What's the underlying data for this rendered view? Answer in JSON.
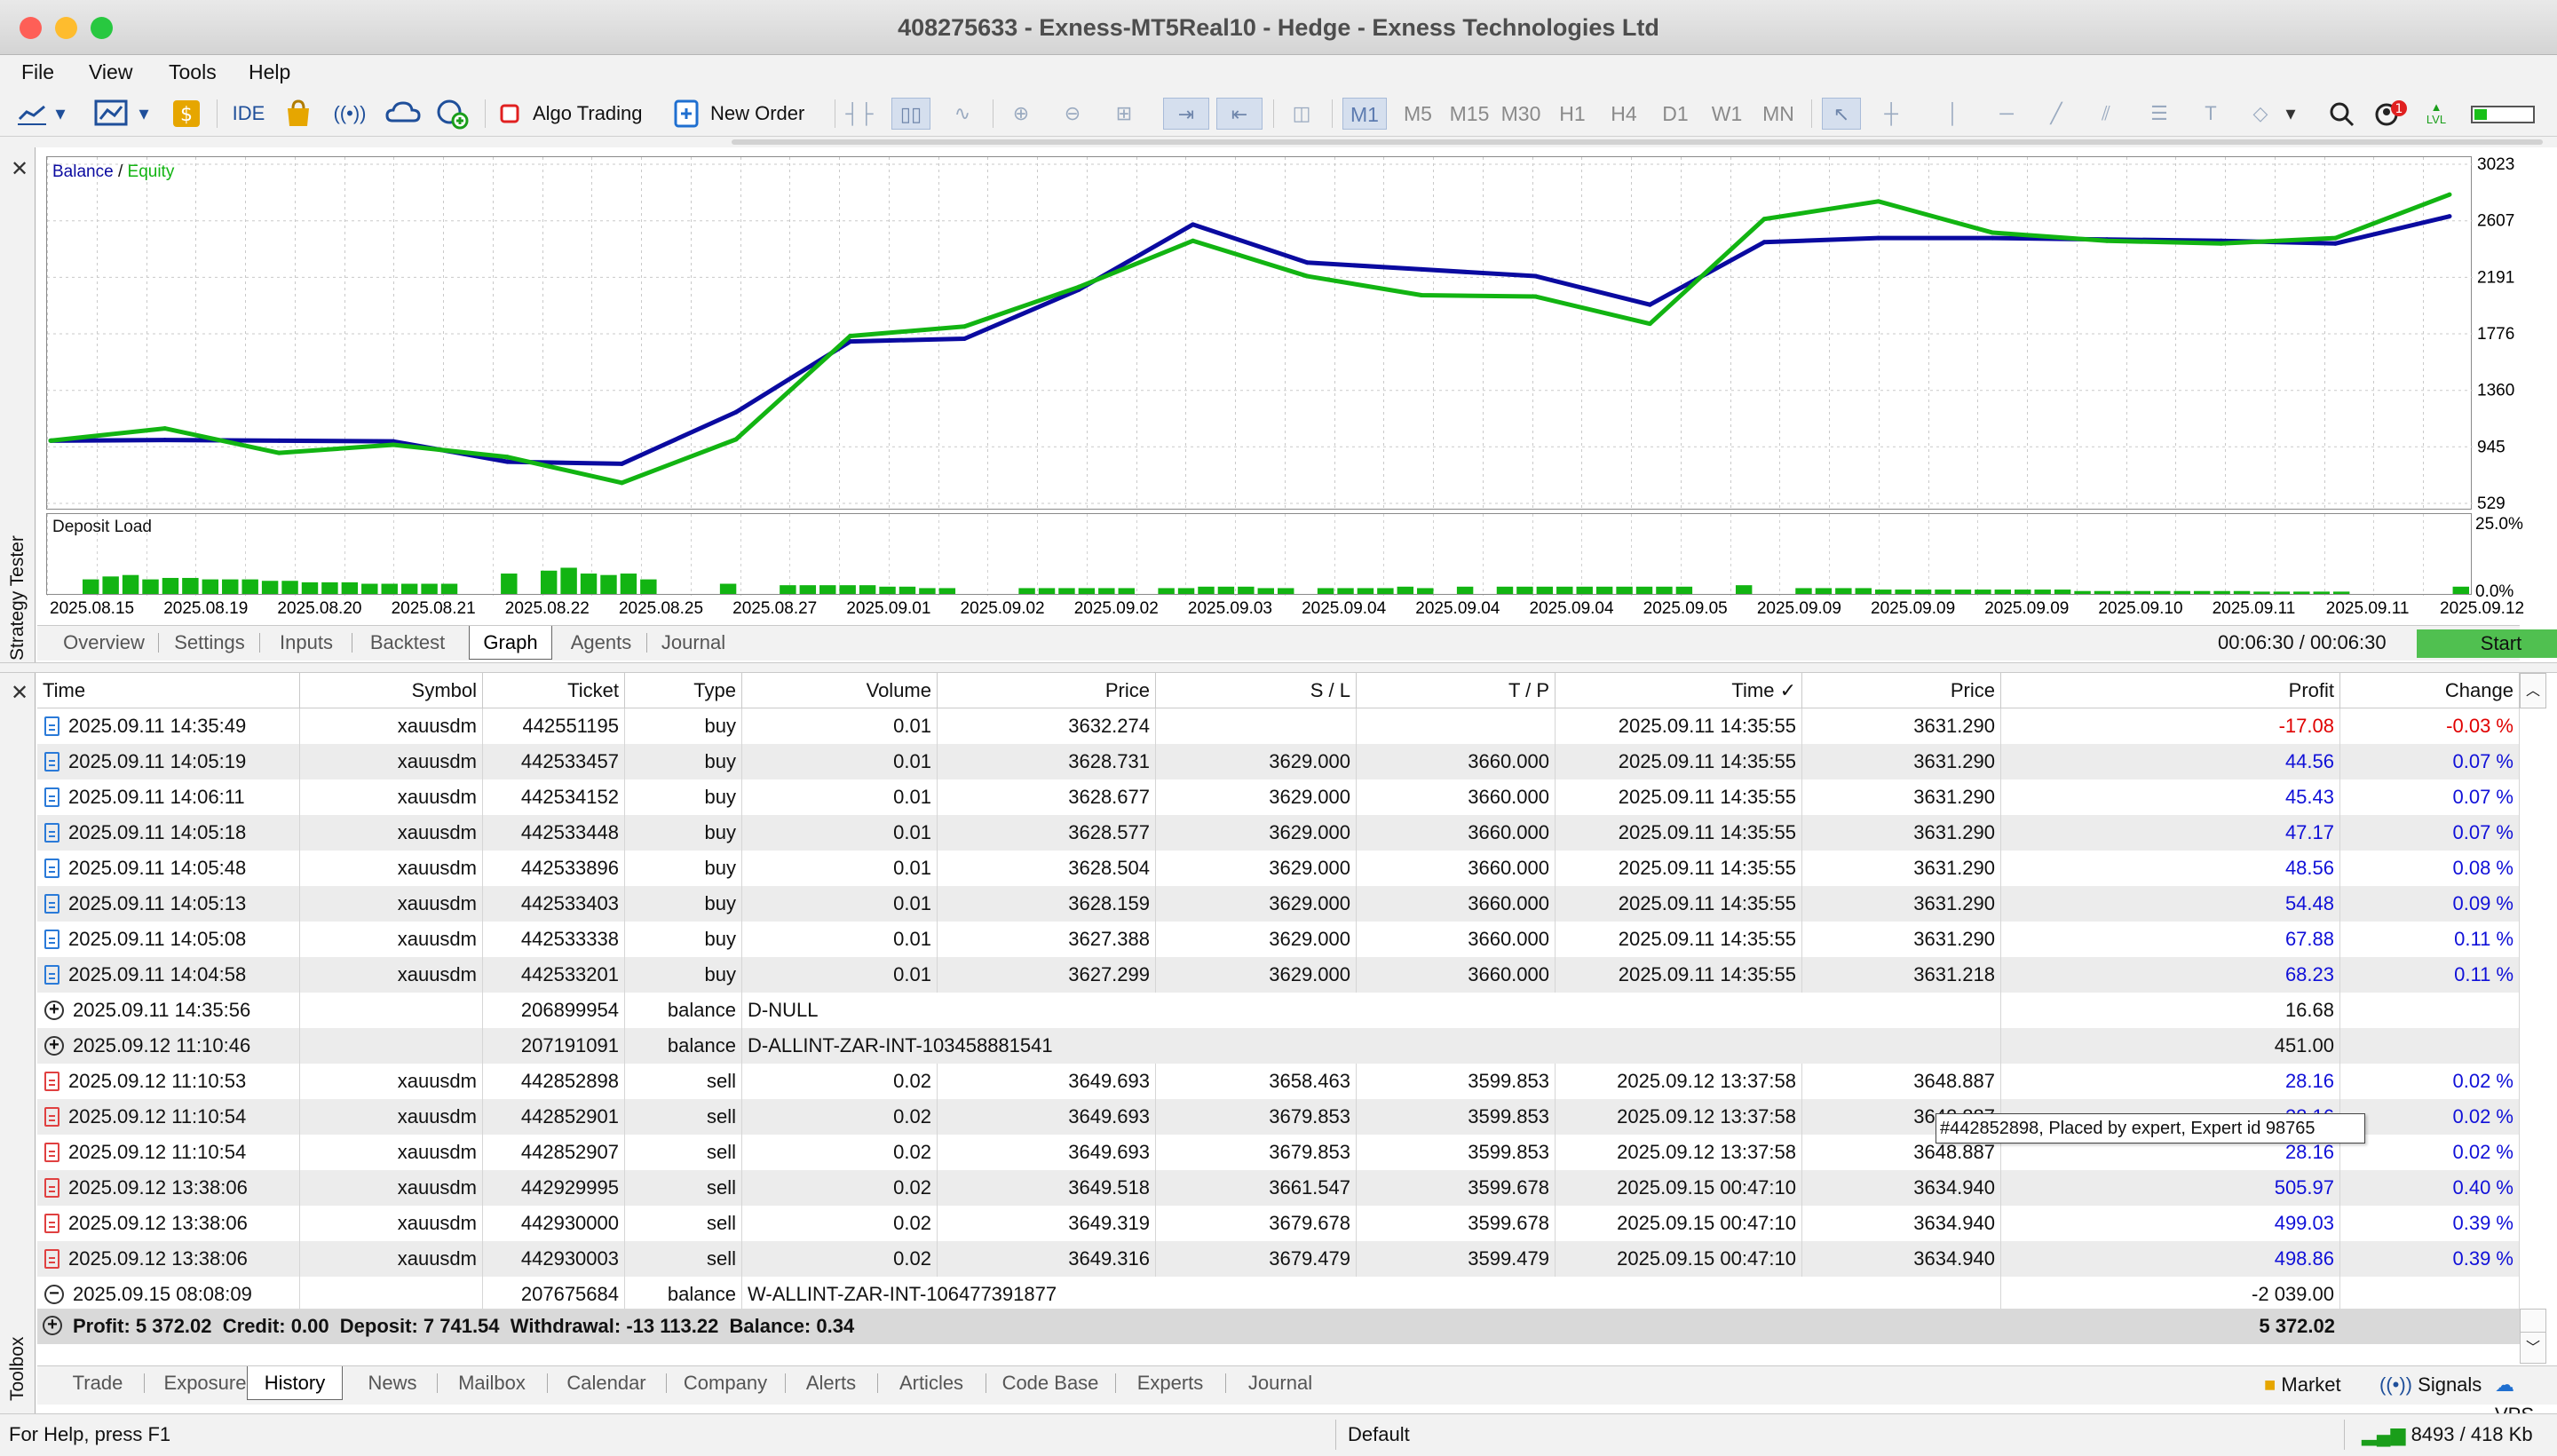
{
  "window": {
    "title": "408275633 - Exness-MT5Real10 - Hedge - Exness Technologies Ltd"
  },
  "menu": {
    "file": "File",
    "view": "View",
    "tools": "Tools",
    "help": "Help"
  },
  "toolbar": {
    "ide": "IDE",
    "algo_trading": "Algo Trading",
    "new_order": "New Order",
    "timeframes": [
      "M1",
      "M5",
      "M15",
      "M30",
      "H1",
      "H4",
      "D1",
      "W1",
      "MN"
    ],
    "active_timeframe": "M1",
    "notification_count": "1",
    "lvl": "LVL"
  },
  "chart": {
    "legend_balance": "Balance",
    "legend_sep": " / ",
    "legend_equity": "Equity",
    "deposit_load_label": "Deposit Load"
  },
  "chart_data": [
    {
      "type": "line",
      "title": "Balance / Equity",
      "x": [
        "2025.08.15",
        "2025.08.19",
        "2025.08.20",
        "2025.08.21",
        "2025.08.22",
        "2025.08.25",
        "2025.08.27",
        "2025.09.01",
        "2025.09.02",
        "2025.09.02",
        "2025.09.03",
        "2025.09.04",
        "2025.09.04",
        "2025.09.04",
        "2025.09.05",
        "2025.09.09",
        "2025.09.09",
        "2025.09.09",
        "2025.09.10",
        "2025.09.11",
        "2025.09.11",
        "2025.09.12"
      ],
      "yticks": [
        "3023",
        "2607",
        "2191",
        "1776",
        "1360",
        "945",
        "529"
      ],
      "ylim": [
        529,
        3023
      ],
      "series": [
        {
          "name": "Balance",
          "color": "#0a0aa0",
          "values": [
            990,
            995,
            990,
            985,
            835,
            820,
            1200,
            1720,
            1740,
            2100,
            2580,
            2300,
            2250,
            2200,
            1990,
            2450,
            2480,
            2480,
            2470,
            2460,
            2440,
            2640
          ]
        },
        {
          "name": "Equity",
          "color": "#12b412",
          "values": [
            990,
            1080,
            900,
            960,
            870,
            680,
            1000,
            1760,
            1830,
            2120,
            2460,
            2200,
            2060,
            2050,
            1850,
            2620,
            2750,
            2520,
            2460,
            2440,
            2480,
            2800
          ]
        }
      ]
    },
    {
      "type": "bar",
      "title": "Deposit Load",
      "yticks": [
        "25.0%",
        "0.0%"
      ],
      "ylim": [
        0,
        25
      ],
      "values": [
        5,
        6,
        6.5,
        5,
        5.5,
        5.5,
        5,
        5,
        5,
        4.5,
        4.5,
        4,
        4,
        4,
        3.5,
        3.5,
        3.5,
        3.5,
        3.5,
        0,
        0,
        7,
        0,
        8,
        9,
        7,
        6.5,
        7,
        5,
        0,
        0,
        0,
        3.5,
        0,
        0,
        3,
        3,
        3,
        3,
        3,
        2.5,
        2.5,
        2,
        2,
        0,
        0,
        0,
        2,
        2,
        2,
        2,
        2,
        2,
        0,
        2,
        2,
        2.5,
        2.5,
        2.5,
        2,
        2,
        0,
        2,
        2,
        2,
        2,
        2.5,
        2,
        0,
        2.5,
        0,
        2.5,
        2.5,
        2.5,
        2.5,
        2.5,
        2.5,
        2.5,
        2.5,
        2.5,
        2.5,
        0,
        0,
        3,
        0,
        0,
        2,
        2,
        2,
        2,
        1.5,
        1.5,
        1.5,
        1.5,
        1.5,
        1.5,
        1.5,
        1.5,
        1.5,
        1.5,
        1,
        1,
        1,
        1,
        1,
        1,
        1,
        1,
        1,
        0.8,
        0.8,
        0.8,
        0.8,
        0.8,
        0,
        0,
        0,
        0,
        0,
        2.5
      ]
    }
  ],
  "tester": {
    "side_label": "Strategy Tester",
    "tabs": [
      "Overview",
      "Settings",
      "Inputs",
      "Backtest",
      "Graph",
      "Agents",
      "Journal"
    ],
    "active_tab": "Graph",
    "timer": "00:06:30 / 00:06:30",
    "start": "Start"
  },
  "history": {
    "columns": [
      "Time",
      "Symbol",
      "Ticket",
      "Type",
      "Volume",
      "Price",
      "S / L",
      "T / P",
      "Time",
      "Price",
      "Profit",
      "Change"
    ],
    "rows": [
      {
        "icon": "buy",
        "time": "2025.09.11 14:35:49",
        "symbol": "xauusdm",
        "ticket": "442551195",
        "type": "buy",
        "volume": "0.01",
        "price": "3632.274",
        "sl": "",
        "tp": "",
        "close_time": "2025.09.11 14:35:55",
        "close_price": "3631.290",
        "profit": "-17.08",
        "change": "-0.03 %",
        "neg": true
      },
      {
        "icon": "buy",
        "time": "2025.09.11 14:05:19",
        "symbol": "xauusdm",
        "ticket": "442533457",
        "type": "buy",
        "volume": "0.01",
        "price": "3628.731",
        "sl": "3629.000",
        "tp": "3660.000",
        "close_time": "2025.09.11 14:35:55",
        "close_price": "3631.290",
        "profit": "44.56",
        "change": "0.07 %"
      },
      {
        "icon": "buy",
        "time": "2025.09.11 14:06:11",
        "symbol": "xauusdm",
        "ticket": "442534152",
        "type": "buy",
        "volume": "0.01",
        "price": "3628.677",
        "sl": "3629.000",
        "tp": "3660.000",
        "close_time": "2025.09.11 14:35:55",
        "close_price": "3631.290",
        "profit": "45.43",
        "change": "0.07 %"
      },
      {
        "icon": "buy",
        "time": "2025.09.11 14:05:18",
        "symbol": "xauusdm",
        "ticket": "442533448",
        "type": "buy",
        "volume": "0.01",
        "price": "3628.577",
        "sl": "3629.000",
        "tp": "3660.000",
        "close_time": "2025.09.11 14:35:55",
        "close_price": "3631.290",
        "profit": "47.17",
        "change": "0.07 %"
      },
      {
        "icon": "buy",
        "time": "2025.09.11 14:05:48",
        "symbol": "xauusdm",
        "ticket": "442533896",
        "type": "buy",
        "volume": "0.01",
        "price": "3628.504",
        "sl": "3629.000",
        "tp": "3660.000",
        "close_time": "2025.09.11 14:35:55",
        "close_price": "3631.290",
        "profit": "48.56",
        "change": "0.08 %"
      },
      {
        "icon": "buy",
        "time": "2025.09.11 14:05:13",
        "symbol": "xauusdm",
        "ticket": "442533403",
        "type": "buy",
        "volume": "0.01",
        "price": "3628.159",
        "sl": "3629.000",
        "tp": "3660.000",
        "close_time": "2025.09.11 14:35:55",
        "close_price": "3631.290",
        "profit": "54.48",
        "change": "0.09 %"
      },
      {
        "icon": "buy",
        "time": "2025.09.11 14:05:08",
        "symbol": "xauusdm",
        "ticket": "442533338",
        "type": "buy",
        "volume": "0.01",
        "price": "3627.388",
        "sl": "3629.000",
        "tp": "3660.000",
        "close_time": "2025.09.11 14:35:55",
        "close_price": "3631.290",
        "profit": "67.88",
        "change": "0.11 %"
      },
      {
        "icon": "buy",
        "time": "2025.09.11 14:04:58",
        "symbol": "xauusdm",
        "ticket": "442533201",
        "type": "buy",
        "volume": "0.01",
        "price": "3627.299",
        "sl": "3629.000",
        "tp": "3660.000",
        "close_time": "2025.09.11 14:35:55",
        "close_price": "3631.218",
        "profit": "68.23",
        "change": "0.11 %"
      },
      {
        "icon": "plus",
        "time": "2025.09.11 14:35:56",
        "symbol": "",
        "ticket": "206899954",
        "type": "balance",
        "comment": "D-NULL",
        "profit": "16.68",
        "balance": true
      },
      {
        "icon": "plus",
        "time": "2025.09.12 11:10:46",
        "symbol": "",
        "ticket": "207191091",
        "type": "balance",
        "comment": "D-ALLINT-ZAR-INT-103458881541",
        "profit": "451.00",
        "balance": true
      },
      {
        "icon": "sell",
        "time": "2025.09.12 11:10:53",
        "symbol": "xauusdm",
        "ticket": "442852898",
        "type": "sell",
        "volume": "0.02",
        "price": "3649.693",
        "sl": "3658.463",
        "tp": "3599.853",
        "close_time": "2025.09.12 13:37:58",
        "close_price": "3648.887",
        "profit": "28.16",
        "change": "0.02 %"
      },
      {
        "icon": "sell",
        "time": "2025.09.12 11:10:54",
        "symbol": "xauusdm",
        "ticket": "442852901",
        "type": "sell",
        "volume": "0.02",
        "price": "3649.693",
        "sl": "3679.853",
        "tp": "3599.853",
        "close_time": "2025.09.12 13:37:58",
        "close_price": "3648.887",
        "profit": "28.16",
        "change": "0.02 %"
      },
      {
        "icon": "sell",
        "time": "2025.09.12 11:10:54",
        "symbol": "xauusdm",
        "ticket": "442852907",
        "type": "sell",
        "volume": "0.02",
        "price": "3649.693",
        "sl": "3679.853",
        "tp": "3599.853",
        "close_time": "2025.09.12 13:37:58",
        "close_price": "3648.887",
        "profit": "28.16",
        "change": "0.02 %"
      },
      {
        "icon": "sell",
        "time": "2025.09.12 13:38:06",
        "symbol": "xauusdm",
        "ticket": "442929995",
        "type": "sell",
        "volume": "0.02",
        "price": "3649.518",
        "sl": "3661.547",
        "tp": "3599.678",
        "close_time": "2025.09.15 00:47:10",
        "close_price": "3634.940",
        "profit": "505.97",
        "change": "0.40 %"
      },
      {
        "icon": "sell",
        "time": "2025.09.12 13:38:06",
        "symbol": "xauusdm",
        "ticket": "442930000",
        "type": "sell",
        "volume": "0.02",
        "price": "3649.319",
        "sl": "3679.678",
        "tp": "3599.678",
        "close_time": "2025.09.15 00:47:10",
        "close_price": "3634.940",
        "profit": "499.03",
        "change": "0.39 %"
      },
      {
        "icon": "sell",
        "time": "2025.09.12 13:38:06",
        "symbol": "xauusdm",
        "ticket": "442930003",
        "type": "sell",
        "volume": "0.02",
        "price": "3649.316",
        "sl": "3679.479",
        "tp": "3599.479",
        "close_time": "2025.09.15 00:47:10",
        "close_price": "3634.940",
        "profit": "498.86",
        "change": "0.39 %"
      },
      {
        "icon": "minus",
        "time": "2025.09.15 08:08:09",
        "symbol": "",
        "ticket": "207675684",
        "type": "balance",
        "comment": "W-ALLINT-ZAR-INT-106477391877",
        "profit": "-2 039.00",
        "balance": true
      }
    ],
    "tooltip": "#442852898, Placed by expert, Expert id 98765",
    "summary": {
      "text": "Profit: 5 372.02  Credit: 0.00  Deposit: 7 741.54  Withdrawal: -13 113.22  Balance: 0.34",
      "total": "5 372.02"
    }
  },
  "toolbox": {
    "side_label": "Toolbox",
    "tabs": [
      "Trade",
      "Exposure",
      "History",
      "News",
      "Mailbox",
      "Calendar",
      "Company",
      "Alerts",
      "Articles",
      "Code Base",
      "Experts",
      "Journal"
    ],
    "active_tab": "History",
    "market": "Market",
    "signals": "Signals",
    "vps": "VPS"
  },
  "status": {
    "help": "For Help, press F1",
    "profile": "Default",
    "traffic": "8493 / 418 Kb"
  }
}
